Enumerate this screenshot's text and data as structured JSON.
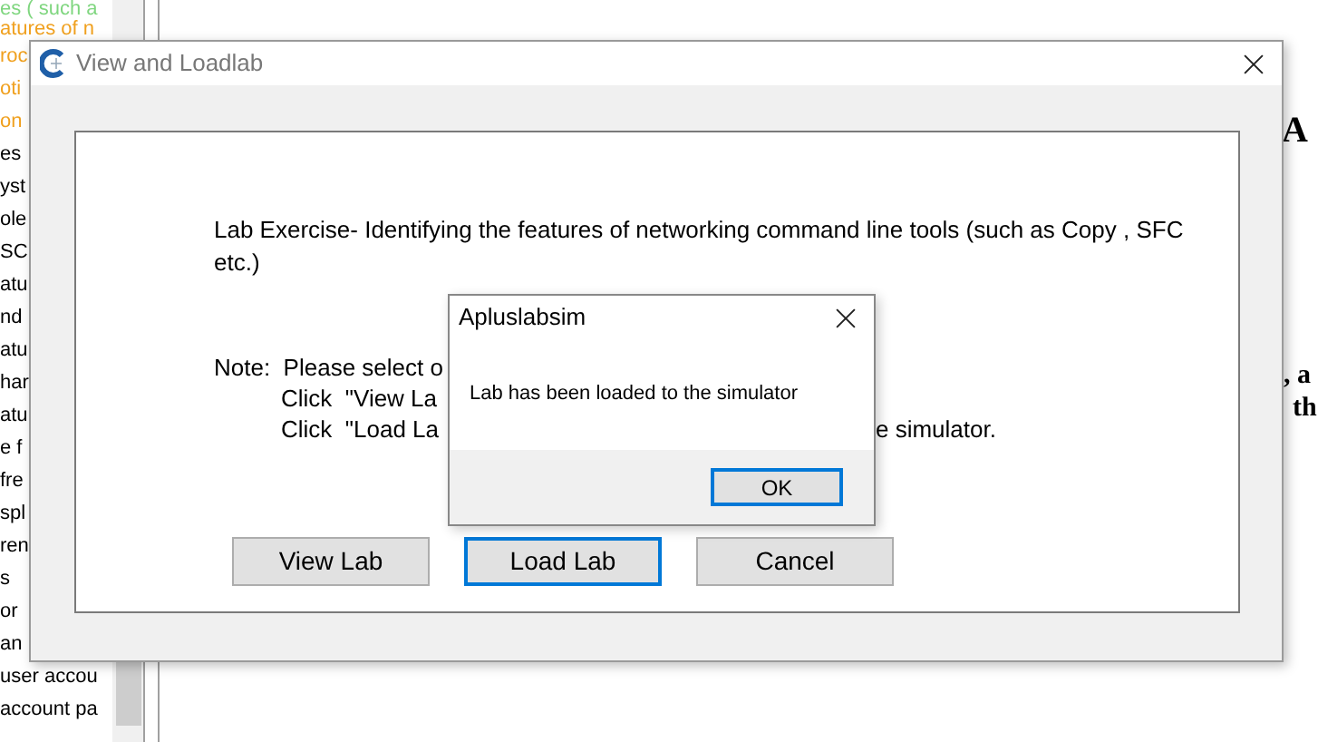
{
  "background_list": {
    "items": [
      {
        "text": "es ( such a",
        "color": "#7fd67f"
      },
      {
        "text": "atures of n",
        "color": "#f0a01e"
      },
      {
        "text": "roc",
        "color": "#f0a01e"
      },
      {
        "text": "oti",
        "color": "#f0a01e"
      },
      {
        "text": "on",
        "color": "#f0a01e"
      },
      {
        "text": "es",
        "color": "#000000"
      },
      {
        "text": "yst",
        "color": "#000000"
      },
      {
        "text": "ole",
        "color": "#000000"
      },
      {
        "text": "SC",
        "color": "#000000"
      },
      {
        "text": "atu",
        "color": "#000000"
      },
      {
        "text": "nd",
        "color": "#000000"
      },
      {
        "text": "atu",
        "color": "#000000"
      },
      {
        "text": "har",
        "color": "#000000"
      },
      {
        "text": "atu",
        "color": "#000000"
      },
      {
        "text": "e f",
        "color": "#000000"
      },
      {
        "text": "fre",
        "color": "#000000"
      },
      {
        "text": "spl",
        "color": "#000000"
      },
      {
        "text": "ren",
        "color": "#000000"
      },
      {
        "text": "s",
        "color": "#000000"
      },
      {
        "text": "or",
        "color": "#000000"
      },
      {
        "text": "an",
        "color": "#000000"
      },
      {
        "text": "user accou",
        "color": "#000000"
      },
      {
        "text": "account pa",
        "color": "#000000"
      }
    ]
  },
  "right_text": [
    {
      "kind": "heading",
      "text": "A"
    },
    {
      "kind": "body",
      "text": ", a"
    },
    {
      "kind": "body",
      "text": "th"
    }
  ],
  "dialog": {
    "title": "View and Loadlab",
    "description": "Lab Exercise- Identifying the features of networking command line tools (such as Copy , SFC etc.)",
    "note_lines": [
      {
        "kind": "lead",
        "text": "Note:  Please select o"
      },
      {
        "kind": "indent",
        "text": "Click  \"View La"
      },
      {
        "kind": "indent",
        "text": "Click  \"Load La",
        "tail": "e simulator."
      }
    ],
    "buttons": [
      {
        "label": "View Lab",
        "selected": false
      },
      {
        "label": "Load Lab",
        "selected": true
      },
      {
        "label": "Cancel",
        "selected": false
      }
    ]
  },
  "message_box": {
    "title": "Apluslabsim",
    "message": "Lab has been loaded to the simulator",
    "button": {
      "label": "OK",
      "selected": true
    }
  }
}
